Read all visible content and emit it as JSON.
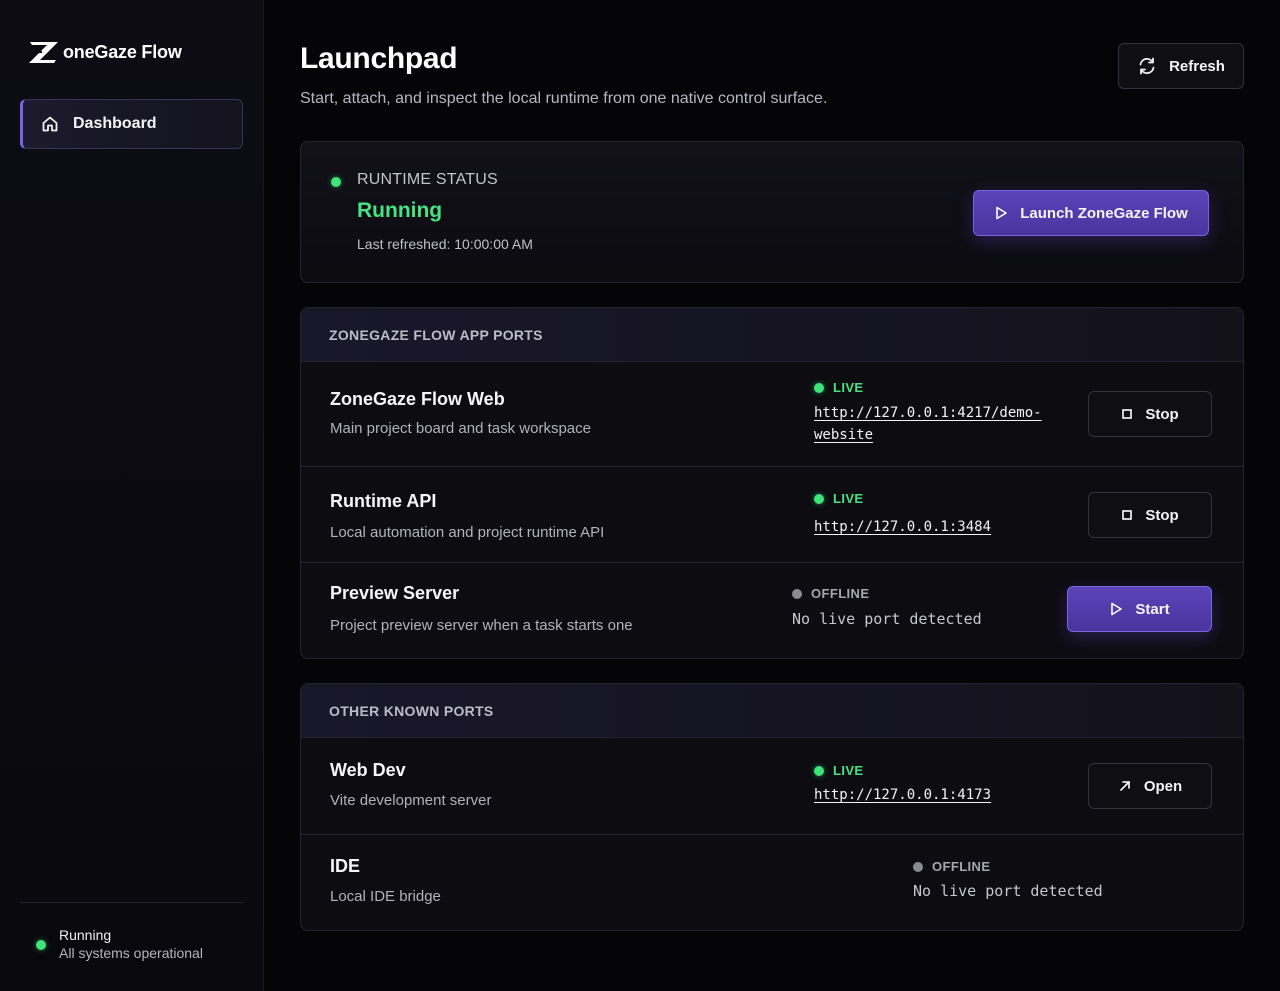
{
  "sidebar": {
    "logo_letter": "Z",
    "logo_text": "oneGaze Flow",
    "nav": [
      {
        "label": "Dashboard",
        "icon": "home-icon"
      }
    ],
    "status": {
      "title": "Running",
      "detail": "All systems operational"
    }
  },
  "header": {
    "title": "Launchpad",
    "subtitle": "Start, attach, and inspect the local runtime from one native control surface.",
    "refresh_label": "Refresh"
  },
  "runtime": {
    "label": "RUNTIME STATUS",
    "state": "Running",
    "last_refreshed": "Last refreshed: 10:00:00 AM",
    "launch_label": "Launch ZoneGaze Flow"
  },
  "app_ports": {
    "header": "ZONEGAZE FLOW APP PORTS",
    "rows": [
      {
        "name": "ZoneGaze Flow Web",
        "desc": "Main project board and task workspace",
        "status": "LIVE",
        "url": "http://127.0.0.1:4217/demo-website",
        "action": "Stop"
      },
      {
        "name": "Runtime API",
        "desc": "Local automation and project runtime API",
        "status": "LIVE",
        "url": "http://127.0.0.1:3484",
        "action": "Stop"
      },
      {
        "name": "Preview Server",
        "desc": "Project preview server when a task starts one",
        "status": "OFFLINE",
        "url": "No live port detected",
        "action": "Start"
      }
    ]
  },
  "other_ports": {
    "header": "OTHER KNOWN PORTS",
    "rows": [
      {
        "name": "Web Dev",
        "desc": "Vite development server",
        "status": "LIVE",
        "url": "http://127.0.0.1:4173",
        "action": "Open"
      },
      {
        "name": "IDE",
        "desc": "Local IDE bridge",
        "status": "OFFLINE",
        "url": "No live port detected"
      }
    ]
  },
  "colors": {
    "accent": "#5a43b8",
    "live": "#46e384",
    "offline": "#8b8b95",
    "background": "#050507"
  }
}
